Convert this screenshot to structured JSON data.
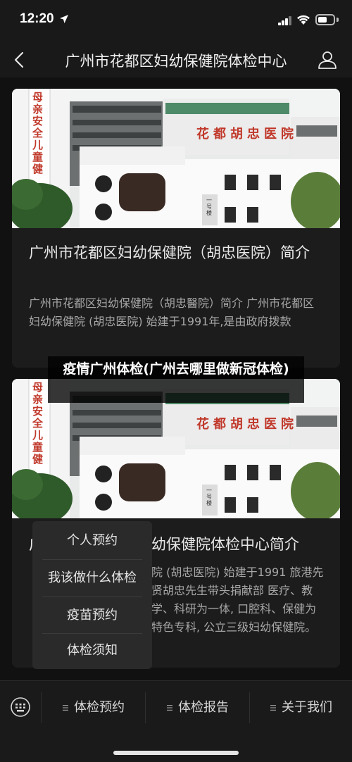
{
  "status_bar": {
    "time": "12:20"
  },
  "nav": {
    "title": "广州市花都区妇幼保健院体检中心"
  },
  "cards": [
    {
      "title": "广州市花都区妇幼保健院（胡忠医院）简介",
      "desc": "广州市花都区妇幼保健院（胡忠醫院）简介   广州市花都区妇幼保健院 (胡忠医院) 始建于1991年,是由政府拨款",
      "sign_text": "花都胡忠医院",
      "banner_text": "母亲安全儿童健",
      "door_plate": "一号楼"
    },
    {
      "title_lead": "广",
      "title": "幼保健院体检中心简介",
      "desc": "院 (胡忠医院) 始建于1991 旅港先贤胡忠先生带头捐献部 医疗、教学、科研为一体, 口腔科、保健为特色专科, 公立三级妇幼保健院。",
      "sign_text": "花都胡忠医院",
      "banner_text": "母亲安全儿童健",
      "door_plate": "一号楼"
    }
  ],
  "overlay": {
    "text": "疫情广州体检(广州去哪里做新冠体检)"
  },
  "popup_menu": {
    "items": [
      "个人预约",
      "我该做什么体检",
      "疫苗预约",
      "体检须知"
    ]
  },
  "bottom_menu": {
    "items": [
      "体检预约",
      "体检报告",
      "关于我们"
    ]
  },
  "icons": {
    "back": "back-arrow-icon",
    "user": "user-icon",
    "keyboard": "keyboard-icon",
    "menu": "menu-lines-icon"
  },
  "colors": {
    "background": "#111111",
    "card": "#1c1c1c",
    "sign_red": "#c0392b"
  }
}
